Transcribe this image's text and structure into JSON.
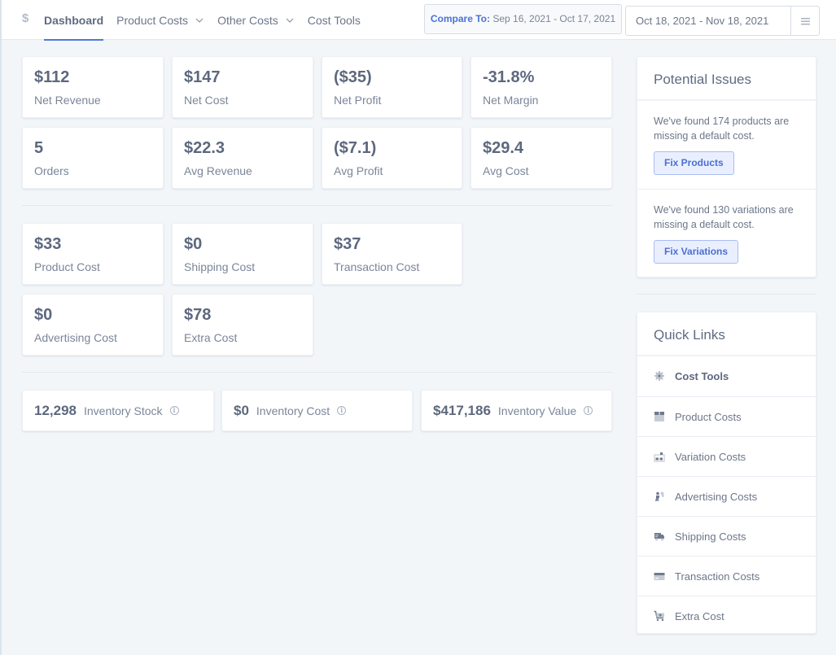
{
  "header": {
    "brand_icon": "dollar-sign",
    "nav": [
      {
        "label": "Dashboard",
        "active": true,
        "dropdown": false
      },
      {
        "label": "Product Costs",
        "active": false,
        "dropdown": true
      },
      {
        "label": "Other Costs",
        "active": false,
        "dropdown": true
      },
      {
        "label": "Cost Tools",
        "active": false,
        "dropdown": false
      }
    ],
    "compare_label": "Compare To:",
    "compare_range": "Sep 16, 2021 - Oct 17, 2021",
    "date_range": "Oct 18, 2021 - Nov 18, 2021",
    "menu_icon": "hamburger-menu"
  },
  "summary": [
    {
      "value": "$112",
      "label": "Net Revenue"
    },
    {
      "value": "$147",
      "label": "Net Cost"
    },
    {
      "value": "($35)",
      "label": "Net Profit"
    },
    {
      "value": "-31.8%",
      "label": "Net Margin"
    },
    {
      "value": "5",
      "label": "Orders"
    },
    {
      "value": "$22.3",
      "label": "Avg Revenue"
    },
    {
      "value": "($7.1)",
      "label": "Avg Profit"
    },
    {
      "value": "$29.4",
      "label": "Avg Cost"
    }
  ],
  "costs": [
    {
      "value": "$33",
      "label": "Product Cost"
    },
    {
      "value": "$0",
      "label": "Shipping Cost"
    },
    {
      "value": "$37",
      "label": "Transaction Cost"
    },
    {
      "value": "$0",
      "label": "Advertising Cost"
    },
    {
      "value": "$78",
      "label": "Extra Cost"
    }
  ],
  "inventory": [
    {
      "value": "12,298",
      "label": "Inventory Stock",
      "icon": "info"
    },
    {
      "value": "$0",
      "label": "Inventory Cost",
      "icon": "info"
    },
    {
      "value": "$417,186",
      "label": "Inventory Value",
      "icon": "info"
    }
  ],
  "issues": {
    "title": "Potential Issues",
    "items": [
      {
        "text": "We've found 174 products are missing a default cost.",
        "button": "Fix Products"
      },
      {
        "text": "We've found 130 variations are missing a default cost.",
        "button": "Fix Variations"
      }
    ]
  },
  "quick_links": {
    "title": "Quick Links",
    "items": [
      {
        "label": "Cost Tools",
        "icon": "gear",
        "bold": true
      },
      {
        "label": "Product Costs",
        "icon": "box",
        "bold": false
      },
      {
        "label": "Variation Costs",
        "icon": "boxes",
        "bold": false
      },
      {
        "label": "Advertising Costs",
        "icon": "person-megaphone",
        "bold": false
      },
      {
        "label": "Shipping Costs",
        "icon": "truck",
        "bold": false
      },
      {
        "label": "Transaction Costs",
        "icon": "credit-card",
        "bold": false
      },
      {
        "label": "Extra Cost",
        "icon": "cart-plus",
        "bold": false
      }
    ]
  },
  "colors": {
    "accent": "#4a7bd6",
    "button_bg": "#eaefff",
    "button_border": "#a9bdf2",
    "page_bg": "#f3f6f9"
  }
}
